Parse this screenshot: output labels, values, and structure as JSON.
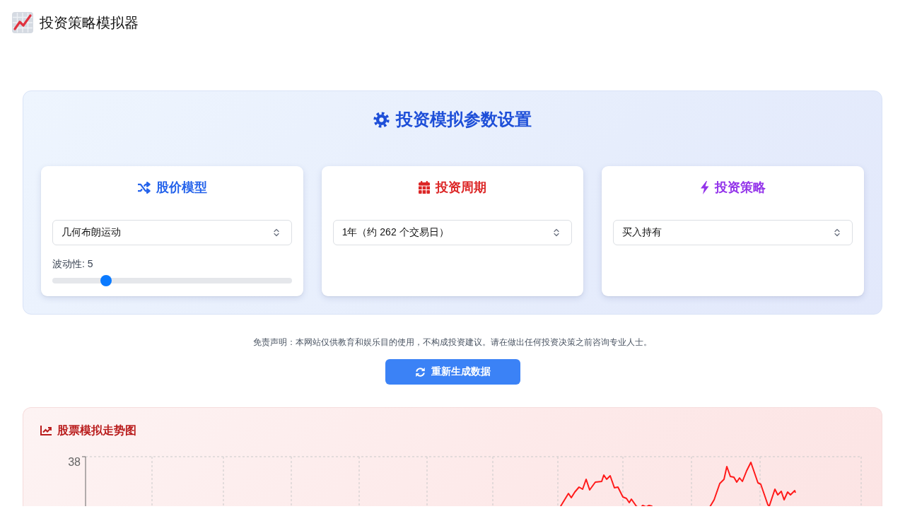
{
  "header": {
    "title": "投资策略模拟器"
  },
  "settings_panel": {
    "title": "投资模拟参数设置",
    "cards": [
      {
        "title": "股价模型",
        "color": "#2563eb",
        "select": {
          "value": "几何布朗运动"
        },
        "slider": {
          "label": "波动性: 5",
          "level": 0.21
        }
      },
      {
        "title": "投资周期",
        "color": "#dc2626",
        "select": {
          "value": "1年（约 262 个交易日）"
        }
      },
      {
        "title": "投资策略",
        "color": "#9333ea",
        "select": {
          "value": "买入持有"
        }
      }
    ]
  },
  "disclaimer": "免责声明：本网站仅供教育和娱乐目的使用，不构成投资建议。请在做出任何投资决策之前咨询专业人士。",
  "regenerate_button": {
    "label": "重新生成数据"
  },
  "chart_panel": {
    "title": "股票模拟走势图",
    "y_tick_label": "38"
  }
}
